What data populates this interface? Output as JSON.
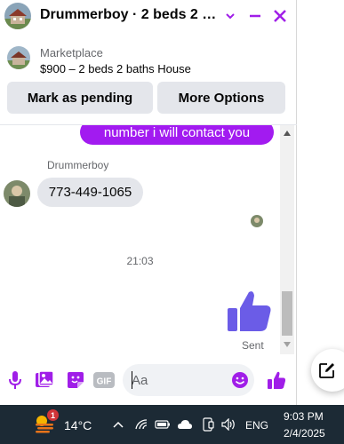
{
  "header": {
    "title": "Drummerboy · 2 beds 2 ba...",
    "icons": [
      "house-avatar",
      "chevron-down-icon",
      "minimize-icon",
      "close-icon"
    ],
    "accent_color": "#a01ee8"
  },
  "listing": {
    "source": "Marketplace",
    "title": "$900 – 2 beds 2 baths House"
  },
  "actions": {
    "mark_pending": "Mark as pending",
    "more_options": "More Options"
  },
  "messages": {
    "outgoing_text": "number i will contact you",
    "sender": "Drummerboy",
    "incoming_text": "773-449-1065",
    "timestamp": "21:03",
    "status": "Sent",
    "outgoing_color": "#a21bf0",
    "like_color": "#6b5ce7"
  },
  "composer": {
    "placeholder": "Aa",
    "icons": [
      "microphone-icon",
      "image-icon",
      "sticker-icon",
      "gif-icon",
      "emoji-icon",
      "like-icon"
    ],
    "gif_label": "GIF"
  },
  "taskbar": {
    "weather_badge": "1",
    "temperature": "14°C",
    "language": "ENG",
    "time": "9:03 PM",
    "date": "2/4/2025",
    "tray_icons": [
      "chevron-up-icon",
      "wifi-icon",
      "battery-icon",
      "cloud-icon",
      "phone-link-icon",
      "volume-icon"
    ]
  }
}
